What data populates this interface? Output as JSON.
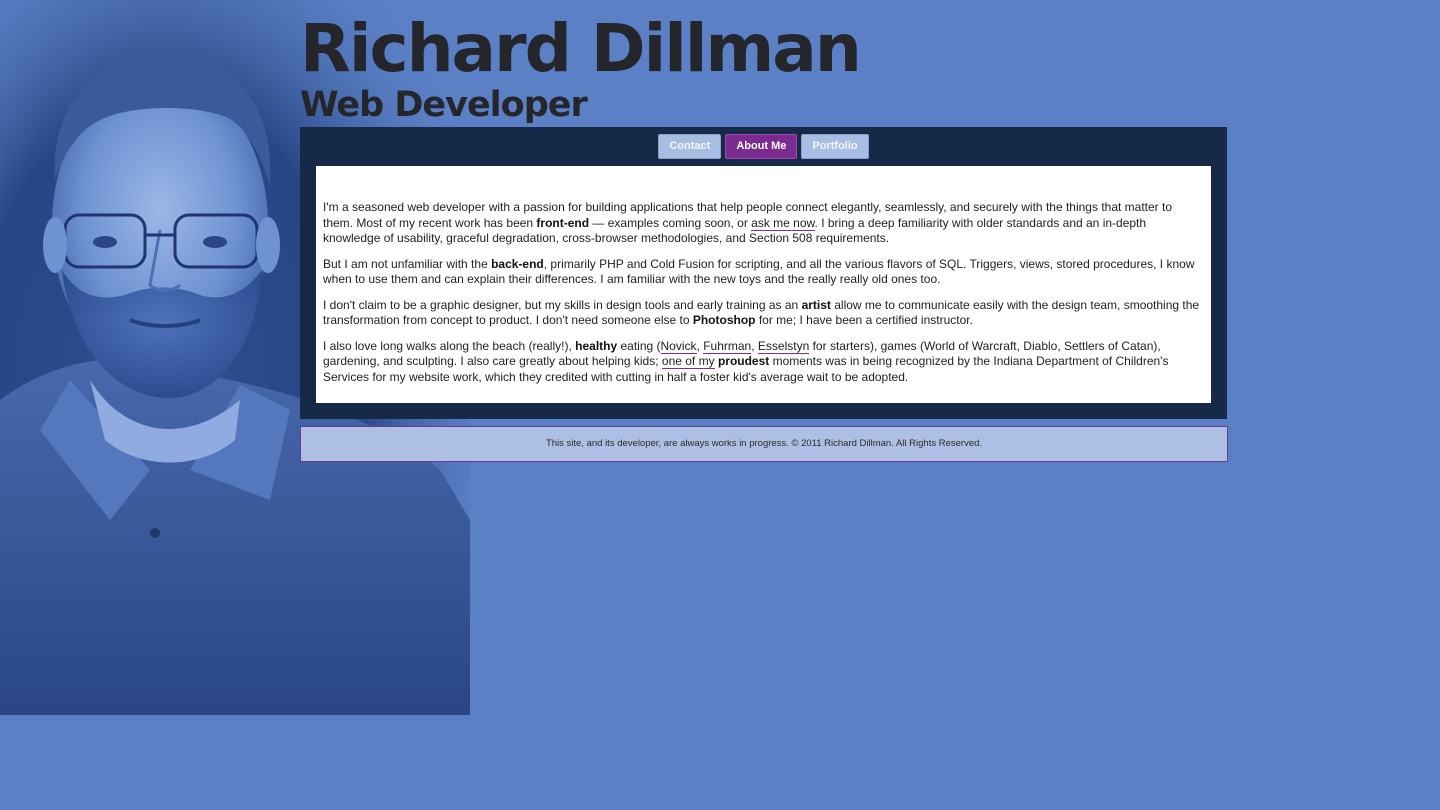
{
  "header": {
    "name": "Richard Dillman",
    "title": "Web Developer"
  },
  "nav": {
    "items": [
      {
        "label": "Contact",
        "active": false
      },
      {
        "label": "About Me",
        "active": true
      },
      {
        "label": "Portfolio",
        "active": false
      }
    ]
  },
  "content": {
    "p1": {
      "t1": "I'm a seasoned web developer with a passion for building applications that help people connect elegantly, seamlessly, and securely with the things that matter to them. Most of my recent work has been ",
      "b1": "front-end",
      "t2": " — examples coming soon, or ",
      "link1": "ask me now",
      "t3": ". I bring a deep familiarity with older standards and an in-depth knowledge of usability, graceful degradation, cross-browser methodologies, and Section 508 requirements."
    },
    "p2": {
      "t1": "But I am not unfamiliar with the ",
      "b1": "back-end",
      "t2": ", primarily PHP and Cold Fusion for scripting, and all the various flavors of SQL. Triggers, views, stored procedures, I know when to use them and can explain their differences. I am familiar with the new toys and the really really old ones too."
    },
    "p3": {
      "t1": "I don't claim to be a graphic designer, but my skills in design tools and early training as an ",
      "b1": "artist",
      "t2": " allow me to communicate easily with the design team, smoothing the transformation from concept to product. I don't need someone else to ",
      "b2": "Photoshop",
      "t3": " for me; I have been a certified instructor."
    },
    "p4": {
      "t1": "I also love long walks along the beach (really!), ",
      "b1": "healthy",
      "t2": " eating (",
      "link1": "Novick",
      "t3": ", ",
      "link2": "Fuhrman",
      "t4": ", ",
      "link3": "Esselstyn",
      "t5": " for starters), games (World of Warcraft, Diablo, Settlers of Catan), gardening, and sculpting. I also care greatly about helping kids; ",
      "u1": "one of my",
      "t6": " ",
      "b2": "proudest",
      "t7": " moments was in being recognized by the Indiana Department of Children's Services for my website work, which they credited with cutting in half a foster kid's average wait to be adopted."
    }
  },
  "footer": {
    "text": "This site, and its developer, are always works in progress. © 2011 Richard Dillman. All Rights Reserved."
  },
  "colors": {
    "background": "#5b80c6",
    "panel": "#162a48",
    "active_tab": "#7b2a8f",
    "inactive_tab": "#a7bde3",
    "footer": "#aebfe4"
  }
}
